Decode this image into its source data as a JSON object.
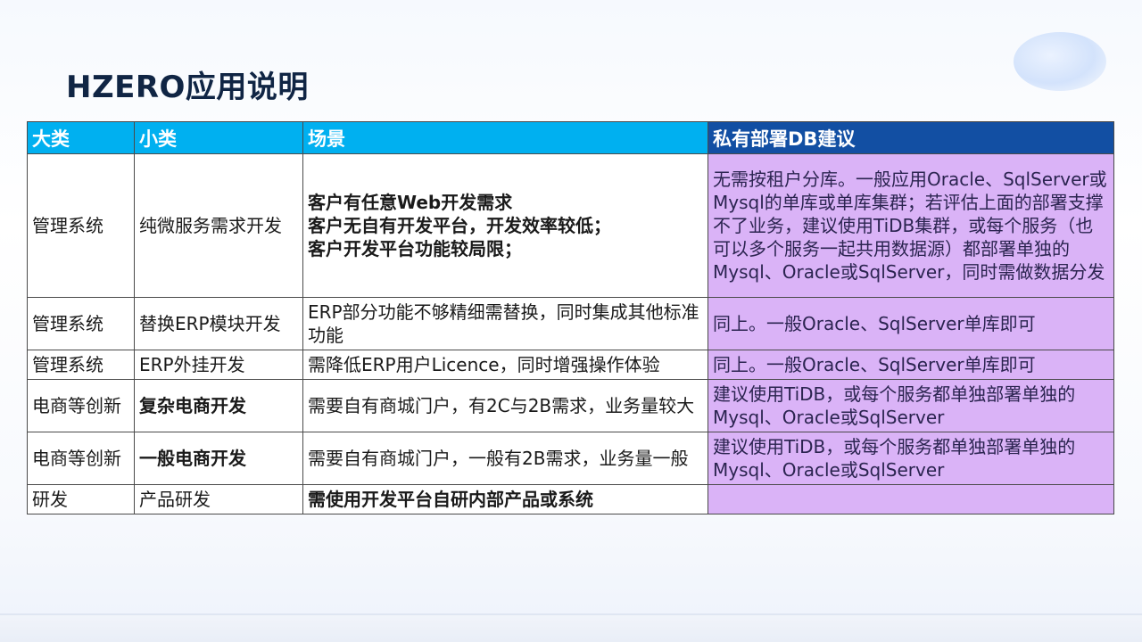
{
  "title": "HZERO应用说明",
  "table": {
    "headers": [
      "大类",
      "小类",
      "场景",
      "私有部署DB建议"
    ],
    "rows": [
      {
        "major": "管理系统",
        "minor": "纯微服务需求开发",
        "scene": [
          "客户有任意Web开发需求",
          "客户无自有开发平台，开发效率较低；",
          "客户开发平台功能较局限；"
        ],
        "db": "无需按租户分库。一般应用Oracle、SqlServer或Mysql的单库或单库集群；若评估上面的部署支撑不了业务，建议使用TiDB集群，或每个服务（也可以多个服务一起共用数据源）都部署单独的Mysql、Oracle或SqlServer，同时需做数据分发"
      },
      {
        "major": "管理系统",
        "minor": "替换ERP模块开发",
        "scene": "ERP部分功能不够精细需替换，同时集成其他标准功能",
        "db": "同上。一般Oracle、SqlServer单库即可"
      },
      {
        "major": "管理系统",
        "minor": "ERP外挂开发",
        "scene": "需降低ERP用户Licence，同时增强操作体验",
        "db": "同上。一般Oracle、SqlServer单库即可"
      },
      {
        "major": "电商等创新",
        "minor": "复杂电商开发",
        "scene": "需要自有商城门户，有2C与2B需求，业务量较大",
        "db": "建议使用TiDB，或每个服务都单独部署单独的Mysql、Oracle或SqlServer"
      },
      {
        "major": "电商等创新",
        "minor": "一般电商开发",
        "scene": "需要自有商城门户，一般有2B需求，业务量一般",
        "db": "建议使用TiDB，或每个服务都单独部署单独的Mysql、Oracle或SqlServer"
      },
      {
        "major": "研发",
        "minor": "产品研发",
        "scene": "需使用开发平台自研内部产品或系统",
        "db": ""
      }
    ]
  },
  "colors": {
    "header_cyan": "#00b0f0",
    "header_blue": "#124fa3",
    "db_column": "#dab3f7",
    "title": "#102544"
  }
}
